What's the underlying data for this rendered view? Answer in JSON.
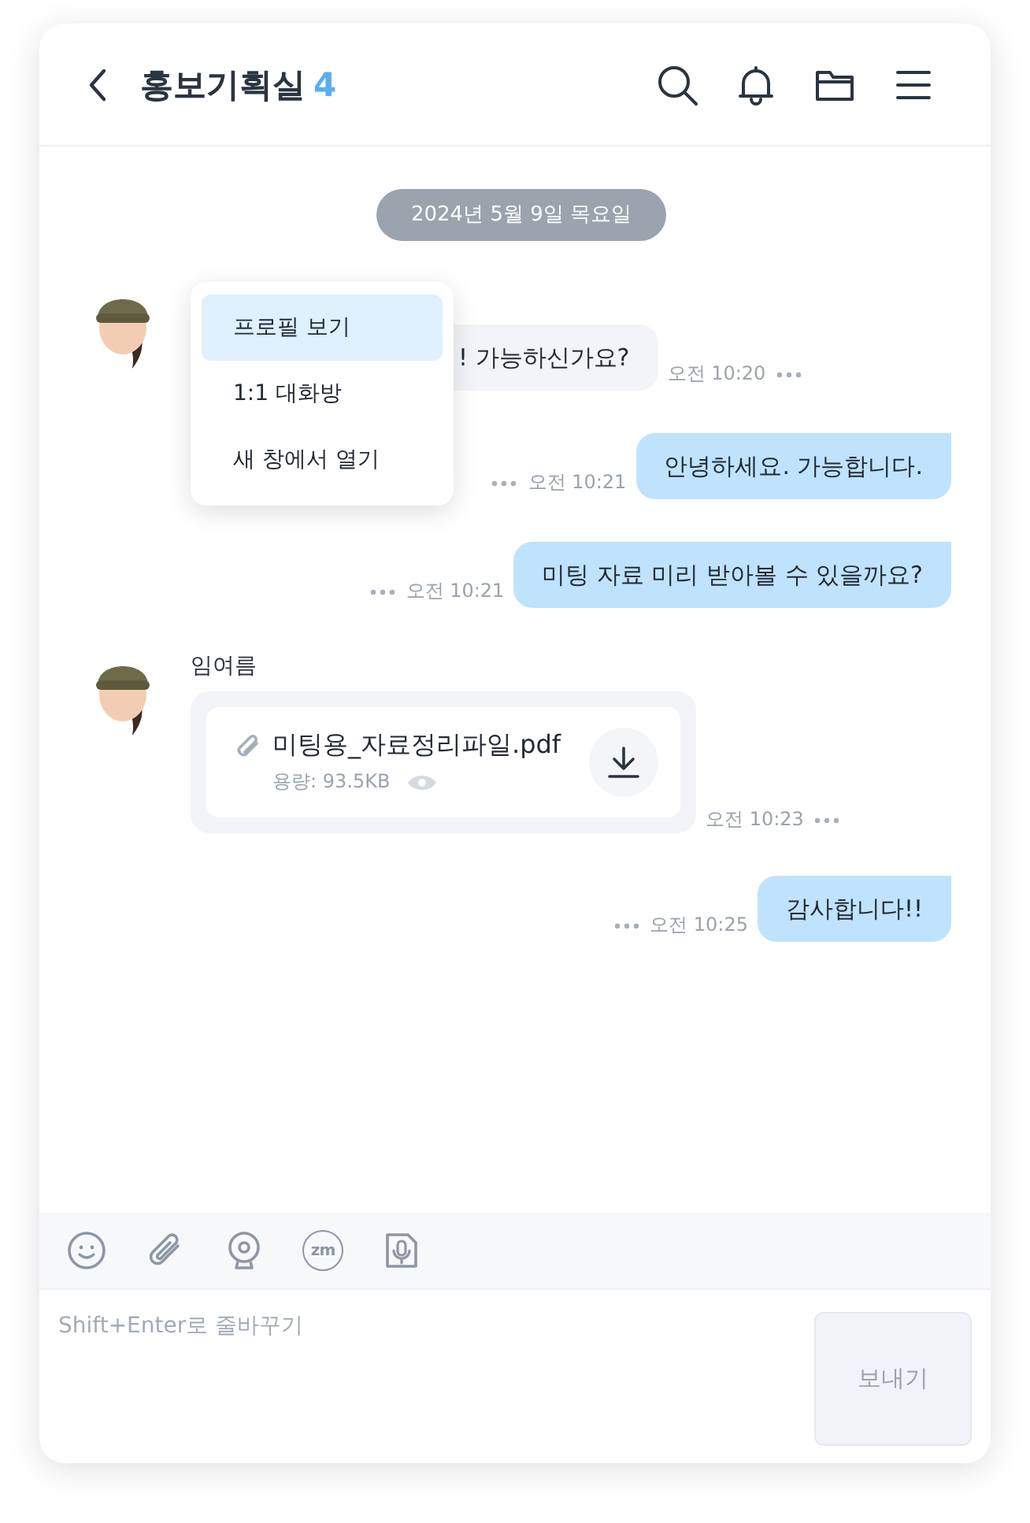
{
  "header": {
    "title": "홍보기획실",
    "member_count": "4"
  },
  "date_divider": "2024년 5월 9일 목요일",
  "messages": [
    {
      "kind": "text",
      "outgoing": false,
      "text": "! 가능하신가요?",
      "time": "오전 10:20"
    },
    {
      "kind": "text",
      "outgoing": true,
      "text": "안녕하세요. 가능합니다.",
      "time": "오전 10:21"
    },
    {
      "kind": "text",
      "outgoing": true,
      "text": "미팅 자료 미리 받아볼 수 있을까요?",
      "time": "오전 10:21"
    },
    {
      "kind": "file",
      "outgoing": false,
      "sender": "임여름",
      "file_name": "미팅용_자료정리파일.pdf",
      "file_size": "용량: 93.5KB",
      "time": "오전 10:23"
    },
    {
      "kind": "text",
      "outgoing": true,
      "text": "감사합니다!!",
      "time": "오전 10:25"
    }
  ],
  "context_menu": {
    "items": [
      {
        "label": "프로필 보기",
        "selected": true
      },
      {
        "label": "1:1 대화방",
        "selected": false
      },
      {
        "label": "새 창에서 열기",
        "selected": false
      }
    ]
  },
  "toolbar": {
    "tools": [
      {
        "kind": "emoji"
      },
      {
        "kind": "attach"
      },
      {
        "kind": "webcam"
      },
      {
        "kind": "zoom",
        "glyph": "zm"
      },
      {
        "kind": "voice"
      }
    ]
  },
  "composer": {
    "placeholder": "Shift+Enter로 줄바꾸기",
    "send_label": "보내기"
  }
}
